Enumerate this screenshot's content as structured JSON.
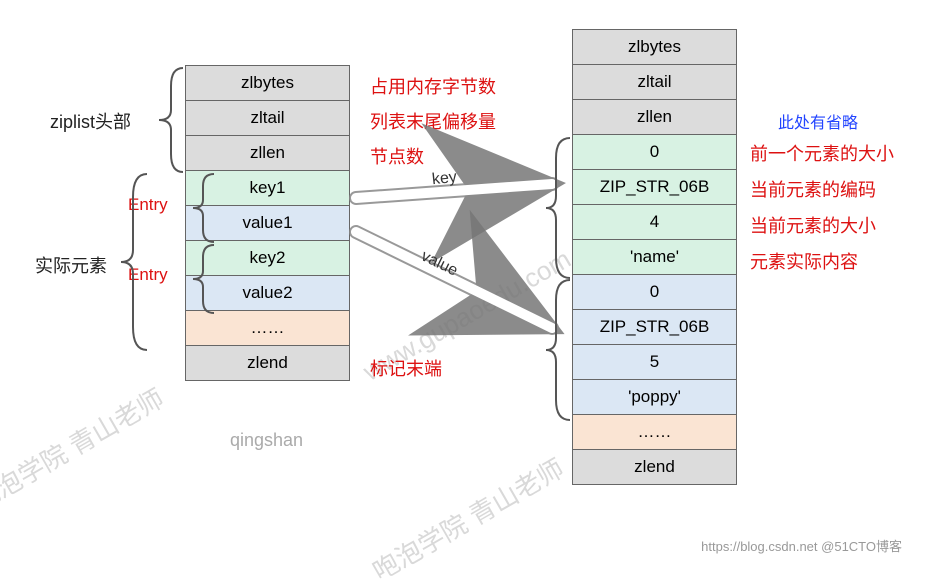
{
  "left": {
    "header_label": "ziplist头部",
    "actual_label": "实际元素",
    "cells": {
      "zlbytes": "zlbytes",
      "zltail": "zltail",
      "zllen": "zllen",
      "key1": "key1",
      "value1": "value1",
      "key2": "key2",
      "value2": "value2",
      "more": "……",
      "zlend": "zlend"
    },
    "entry_tag": "Entry",
    "desc": {
      "zlbytes": "占用内存字节数",
      "zltail": "列表末尾偏移量",
      "zllen": "节点数",
      "zlend": "标记末端"
    },
    "arrow_key": "key",
    "arrow_value": "value"
  },
  "right": {
    "note": "此处有省略",
    "cells": {
      "zlbytes": "zlbytes",
      "zltail": "zltail",
      "zllen": "zllen",
      "k_prev": "0",
      "k_enc": "ZIP_STR_06B",
      "k_len": "4",
      "k_val": "'name'",
      "v_prev": "0",
      "v_enc": "ZIP_STR_06B",
      "v_len": "5",
      "v_val": "'poppy'",
      "more": "……",
      "zlend": "zlend"
    },
    "desc": {
      "prev": "前一个元素的大小",
      "enc": "当前元素的编码",
      "len": "当前元素的大小",
      "val": "元素实际内容"
    }
  },
  "footer_author": "qingshan",
  "credit": "https://blog.csdn.net  @51CTO博客",
  "watermarks": [
    "咆泡学院 青山老师",
    "www.gupaoedu.com",
    "咆泡学院 青山老师"
  ],
  "chart_data": {
    "type": "table",
    "title": "Redis ziplist memory layout",
    "left_structure": [
      {
        "field": "zlbytes",
        "group": "header",
        "meaning": "占用内存字节数"
      },
      {
        "field": "zltail",
        "group": "header",
        "meaning": "列表末尾偏移量"
      },
      {
        "field": "zllen",
        "group": "header",
        "meaning": "节点数"
      },
      {
        "field": "key1",
        "group": "entry1.key"
      },
      {
        "field": "value1",
        "group": "entry1.value"
      },
      {
        "field": "key2",
        "group": "entry2.key"
      },
      {
        "field": "value2",
        "group": "entry2.value"
      },
      {
        "field": "……",
        "group": "more"
      },
      {
        "field": "zlend",
        "group": "tail",
        "meaning": "标记末端"
      }
    ],
    "right_structure": [
      {
        "field": "zlbytes"
      },
      {
        "field": "zltail"
      },
      {
        "field": "zllen"
      },
      {
        "field": "0",
        "meaning": "前一个元素的大小",
        "expands": "key1"
      },
      {
        "field": "ZIP_STR_06B",
        "meaning": "当前元素的编码",
        "expands": "key1"
      },
      {
        "field": "4",
        "meaning": "当前元素的大小",
        "expands": "key1"
      },
      {
        "field": "'name'",
        "meaning": "元素实际内容",
        "expands": "key1"
      },
      {
        "field": "0",
        "expands": "value1"
      },
      {
        "field": "ZIP_STR_06B",
        "expands": "value1"
      },
      {
        "field": "5",
        "expands": "value1"
      },
      {
        "field": "'poppy'",
        "expands": "value1"
      },
      {
        "field": "……"
      },
      {
        "field": "zlend"
      }
    ]
  }
}
